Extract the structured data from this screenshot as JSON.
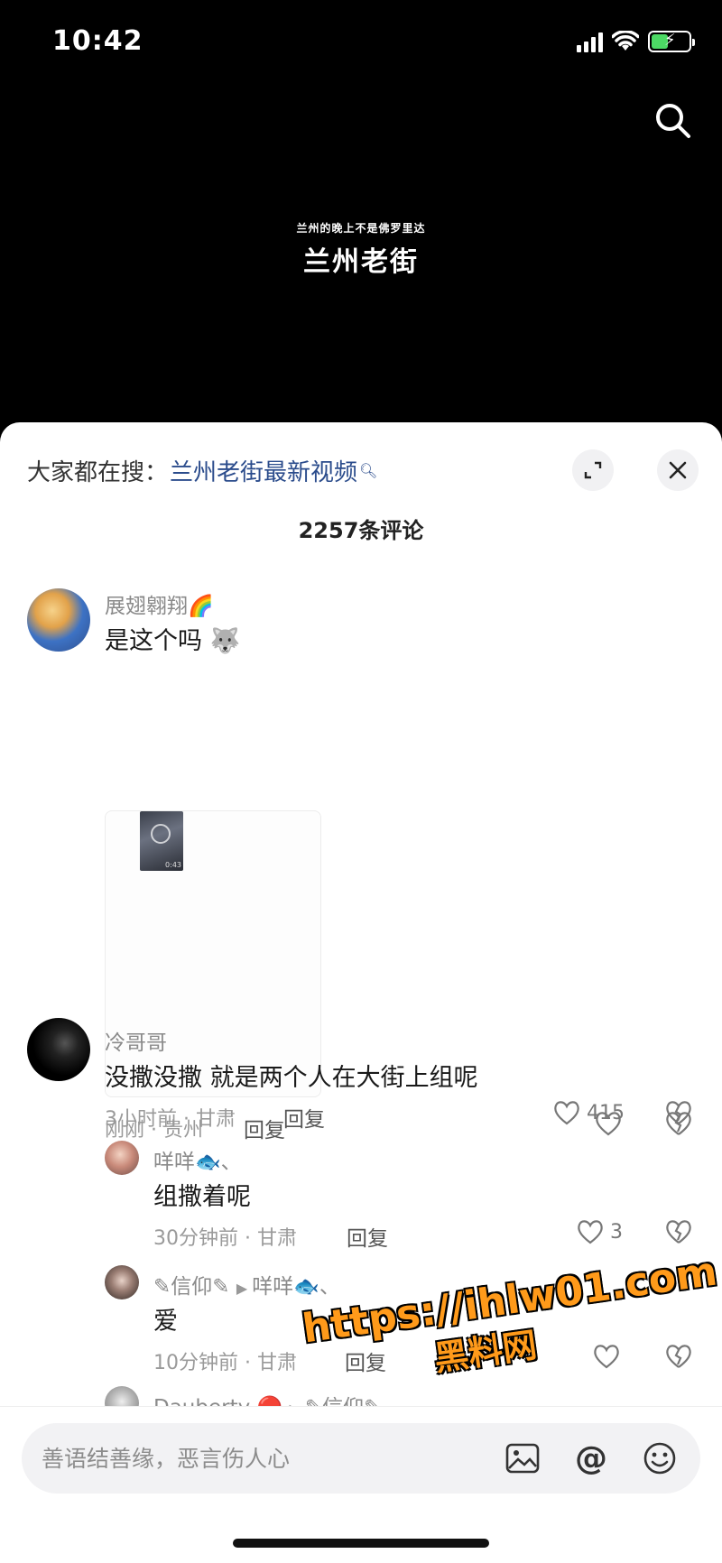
{
  "status": {
    "time": "10:42"
  },
  "video": {
    "subtitle": "兰州的晚上不是佛罗里达",
    "title": "兰州老街"
  },
  "sheet": {
    "hot_search_label": "大家都在搜：",
    "hot_search_link": "兰州老街最新视频",
    "comment_count": "2257条评论"
  },
  "comments": [
    {
      "user": "展翅翱翔🌈",
      "text": "是这个吗 🐺",
      "meta": "刚刚 · 贵州",
      "reply": "回复",
      "likes": "",
      "media_duration": "0:43"
    },
    {
      "user": "冷哥哥",
      "text": "没撒没撒 就是两个人在大街上组呢",
      "meta": "3小时前 · 甘肃",
      "reply": "回复",
      "likes": "415"
    }
  ],
  "replies": [
    {
      "user": "咩咩🐟、",
      "text": "组撒着呢",
      "meta": "30分钟前 · 甘肃",
      "reply": "回复",
      "likes": "3"
    },
    {
      "user": "✎信仰✎",
      "reply_to": "咩咩🐟、",
      "text": "爱",
      "meta": "10分钟前 · 甘肃",
      "reply": "回复",
      "likes": ""
    },
    {
      "user": "Dauberty 🔴",
      "reply_to": "✎信仰✎"
    }
  ],
  "watermark": {
    "url": "https://ihlw01.com",
    "name": "黑料网"
  },
  "input": {
    "placeholder": "善语结善缘，恶言伤人心"
  }
}
